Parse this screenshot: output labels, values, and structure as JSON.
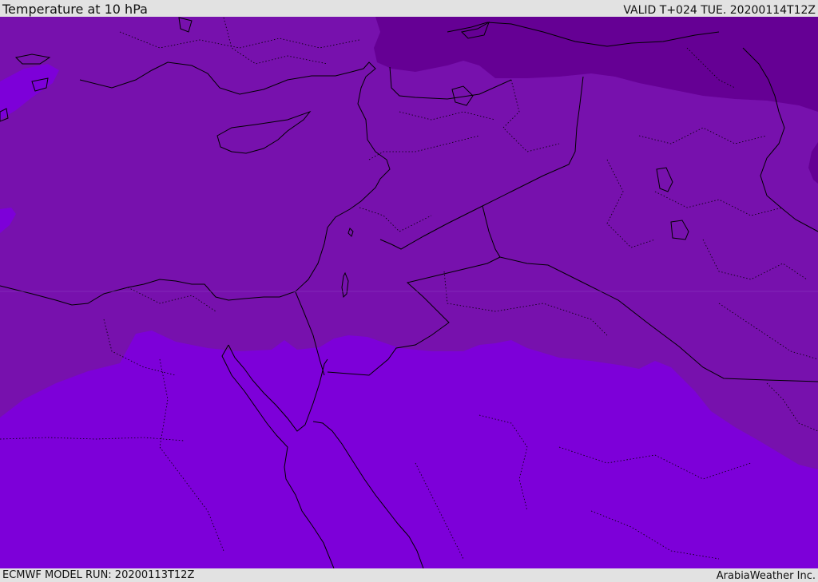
{
  "header": {
    "title": "Temperature at 10 hPa",
    "valid": "VALID T+024 TUE. 20200114T12Z"
  },
  "footer": {
    "model_run": "ECMWF MODEL RUN: 20200113T12Z",
    "credit": "ArabiaWeather Inc."
  },
  "map": {
    "fill_colors": {
      "coldest": "#650094",
      "cold": "#7711ad",
      "warm": "#7d00d9",
      "outline": "#000000"
    }
  }
}
